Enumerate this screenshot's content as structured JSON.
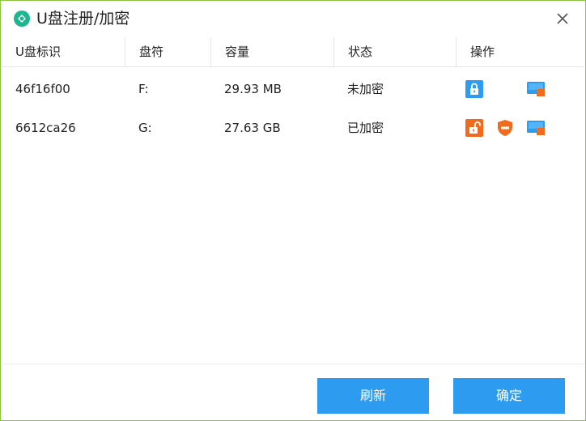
{
  "window": {
    "title": "U盘注册/加密"
  },
  "table": {
    "headers": [
      "U盘标识",
      "盘符",
      "容量",
      "状态",
      "操作"
    ],
    "rows": [
      {
        "id": "46f16f00",
        "drive": "F:",
        "capacity": "29.93 MB",
        "status": "未加密",
        "actions": [
          "lock-icon",
          "drive-icon"
        ]
      },
      {
        "id": "6612ca26",
        "drive": "G:",
        "capacity": "27.63 GB",
        "status": "已加密",
        "actions": [
          "unlock-icon",
          "shield-minus-icon",
          "drive-icon"
        ]
      }
    ]
  },
  "buttons": {
    "refresh": "刷新",
    "confirm": "确定"
  },
  "colors": {
    "accent_blue": "#2d9cf0",
    "accent_orange": "#f06b1e",
    "border_green": "#8cc63f"
  }
}
